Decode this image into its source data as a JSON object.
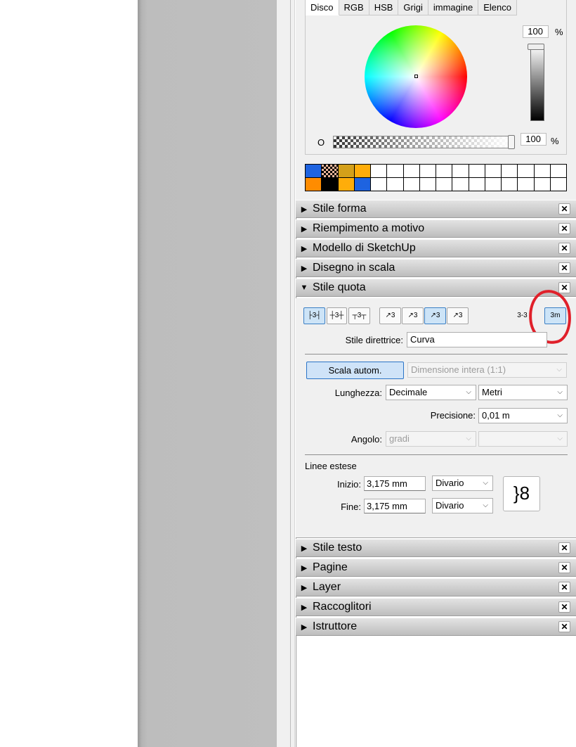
{
  "color_tabs": [
    "Disco",
    "RGB",
    "HSB",
    "Grigi",
    "immagine",
    "Elenco"
  ],
  "brightness_value": "100",
  "brightness_unit": "%",
  "opacity_label": "O",
  "opacity_value": "100",
  "opacity_unit": "%",
  "swatches": [
    "#1e63e0",
    "checker",
    "#d4a01a",
    "#ffad0a",
    "#ffffff",
    "#ffffff",
    "#ffffff",
    "#ffffff",
    "#ffffff",
    "#ffffff",
    "#ffffff",
    "#ffffff",
    "#ffffff",
    "#ffffff",
    "#ffffff",
    "#ffffff",
    "#ff8c00",
    "#000000",
    "#ffad0a",
    "#1e63e0",
    "#ffffff",
    "#ffffff",
    "#ffffff",
    "#ffffff",
    "#ffffff",
    "#ffffff",
    "#ffffff",
    "#ffffff",
    "#ffffff",
    "#ffffff",
    "#ffffff",
    "#ffffff"
  ],
  "panels_top": [
    "Stile forma",
    "Riempimento a motivo",
    "Modello di SketchUp",
    "Disegno in scala"
  ],
  "dim_panel_title": "Stile quota",
  "dim_icons": [
    "├3┤",
    "┼3┼",
    "┬3┬",
    "↗3",
    "↗3",
    "↗3",
    "↗3",
    "3-3",
    "3m"
  ],
  "leader_style_label": "Stile direttrice:",
  "leader_style_value": "Curva",
  "auto_scale_label": "Scala autom.",
  "scale_value": "Dimensione intera (1:1)",
  "length_label": "Lunghezza:",
  "length_format": "Decimale",
  "length_unit": "Metri",
  "precision_label": "Precisione:",
  "precision_value": "0,01 m",
  "angle_label": "Angolo:",
  "angle_unit": "gradi",
  "angle_precision": "",
  "ext_lines_label": "Linee estese",
  "start_label": "Inizio:",
  "start_value": "3,175 mm",
  "start_mode": "Divario",
  "end_label": "Fine:",
  "end_value": "3,175 mm",
  "end_mode": "Divario",
  "link_icon": "}8",
  "panels_bottom": [
    "Stile testo",
    "Pagine",
    "Layer",
    "Raccoglitori",
    "Istruttore"
  ],
  "close_glyph": "✕",
  "collapsed_glyph": "▶",
  "expanded_glyph": "▼",
  "dropdown_glyph": "⌵",
  "annotation_color": "#e0202a"
}
